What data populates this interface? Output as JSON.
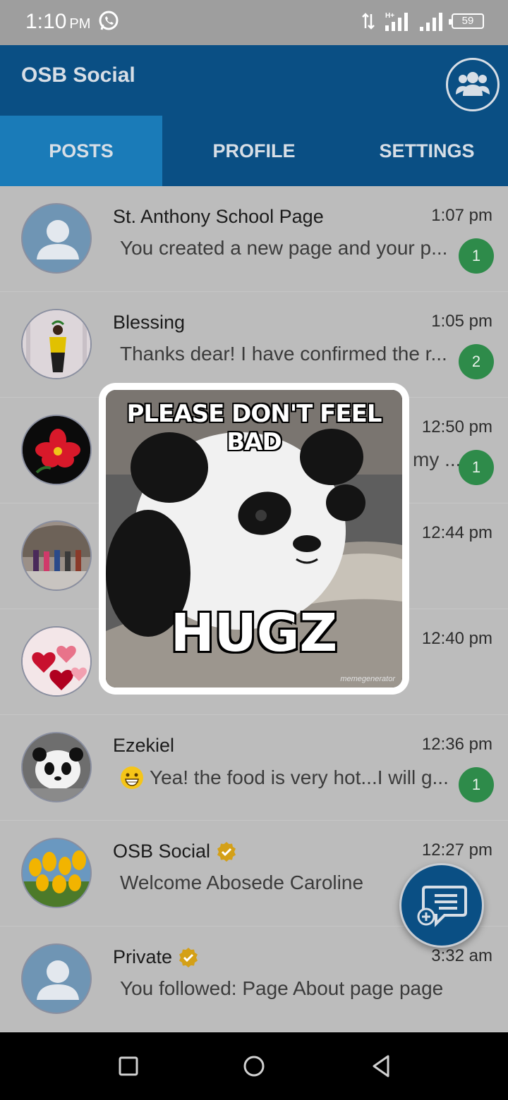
{
  "status_bar": {
    "time": "1:10",
    "ampm": "PM",
    "battery": "59",
    "icons": [
      "whatsapp-icon",
      "data-transfer-icon",
      "signal-hplus-icon",
      "signal-icon",
      "battery-icon"
    ]
  },
  "app_bar": {
    "title": "OSB Social",
    "group_icon": "group-icon"
  },
  "tabs": [
    {
      "label": "POSTS",
      "active": true
    },
    {
      "label": "PROFILE",
      "active": false
    },
    {
      "label": "SETTINGS",
      "active": false
    }
  ],
  "posts": [
    {
      "name": "St. Anthony School Page",
      "time": "1:07 pm",
      "message": "You created a new page and your p...",
      "badge": "1"
    },
    {
      "name": "Blessing",
      "time": "1:05 pm",
      "message": "Thanks dear! I have confirmed the r...",
      "badge": "2"
    },
    {
      "name": "",
      "time": "12:50 pm",
      "message": "my ...",
      "badge": "1"
    },
    {
      "name": "",
      "time": "12:44 pm",
      "message": ""
    },
    {
      "name": "",
      "time": "12:40 pm",
      "message": ""
    },
    {
      "name": "Ezekiel",
      "time": "12:36 pm",
      "message": "Yea! the food is very hot...I will g...",
      "badge": "1"
    },
    {
      "name": "OSB Social",
      "time": "12:27 pm",
      "message": "Welcome Abosede Caroline"
    },
    {
      "name": "Private",
      "time": "3:32 am",
      "message": "You followed: Page About page page"
    }
  ],
  "popup": {
    "top_text": "PLEASE DON'T FEEL BAD",
    "bottom_text": "HUGZ",
    "credit": "memegenerator"
  },
  "colors": {
    "app_bar": "#0a4f84",
    "active_tab": "#1a7bb8",
    "badge": "#2e8b4a",
    "verified": "#d4a017"
  }
}
